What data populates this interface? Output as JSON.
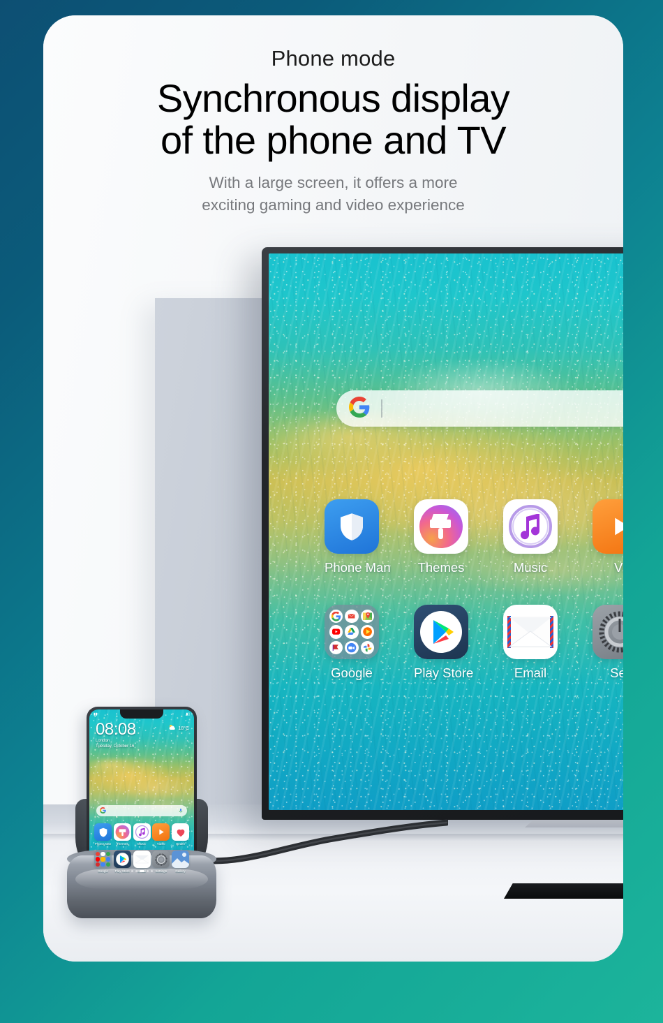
{
  "header": {
    "kicker": "Phone mode",
    "headline_line1": "Synchronous display",
    "headline_line2": "of the phone and TV",
    "sub_line1": "With a large screen, it offers a more",
    "sub_line2": "exciting gaming and video experience"
  },
  "colors": {
    "border_start": "#0d4f73",
    "border_end": "#1cb49b",
    "card_bg": "#f7f8fa",
    "headline": "#000000",
    "subcopy": "#77797d",
    "tv_bezel": "#1b1e21",
    "wallpaper_top": "#19c2cf",
    "wallpaper_sand": "#ecCB5f",
    "wallpaper_bottom": "#0f9ec6",
    "dock_metal": "#7d848f"
  },
  "tv": {
    "search": {
      "icon": "google-g-icon",
      "value": "",
      "placeholder": ""
    },
    "app_rows": [
      [
        {
          "label": "Phone Man",
          "icon": "shield-icon"
        },
        {
          "label": "Themes",
          "icon": "paintbrush-icon"
        },
        {
          "label": "Music",
          "icon": "music-note-icon"
        },
        {
          "label": "Vi",
          "icon": "video-play-icon"
        }
      ],
      [
        {
          "label": "Google",
          "icon": "google-folder-icon"
        },
        {
          "label": "Play Store",
          "icon": "play-store-icon"
        },
        {
          "label": "Email",
          "icon": "envelope-icon"
        },
        {
          "label": "Set",
          "icon": "settings-gear-icon"
        }
      ]
    ],
    "google_folder_apps": [
      "google-search-icon",
      "gmail-icon",
      "maps-icon",
      "youtube-icon",
      "drive-icon",
      "play-music-icon",
      "play-movies-icon",
      "duo-icon",
      "photos-icon"
    ]
  },
  "phone": {
    "status_left": "signal-icon",
    "status_right": "battery-icon",
    "clock": {
      "time": "08:08",
      "city": "London",
      "date": "Tuesday, October 16"
    },
    "weather": {
      "icon": "cloud-sun-icon",
      "temperature": "18°C"
    },
    "search": {
      "icon": "google-g-icon",
      "mic": "microphone-icon",
      "value": ""
    },
    "app_rows": [
      [
        {
          "label": "Phone Man",
          "icon": "shield-icon"
        },
        {
          "label": "Themes",
          "icon": "paintbrush-icon"
        },
        {
          "label": "Music",
          "icon": "music-note-icon"
        },
        {
          "label": "Video",
          "icon": "video-play-icon"
        },
        {
          "label": "Health",
          "icon": "heart-icon"
        }
      ],
      [
        {
          "label": "Google",
          "icon": "google-folder-icon"
        },
        {
          "label": "Play Store",
          "icon": "play-store-icon"
        },
        {
          "label": "Email",
          "icon": "envelope-icon"
        },
        {
          "label": "Settings",
          "icon": "settings-gear-icon"
        },
        {
          "label": "Gallery",
          "icon": "gallery-icon"
        }
      ]
    ],
    "page_dots": 5,
    "active_page": 3
  }
}
